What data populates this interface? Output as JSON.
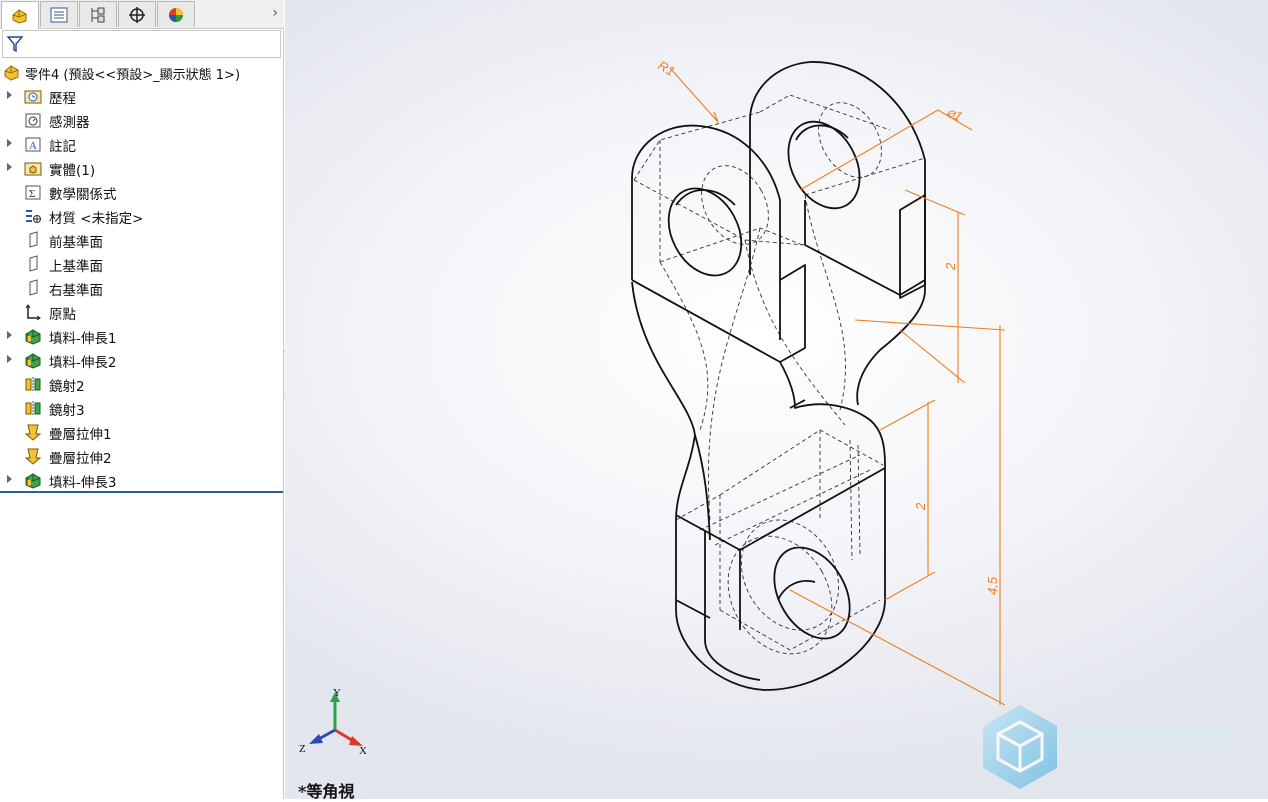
{
  "tabs": [
    {
      "icon": "feature-manager-icon",
      "active": true
    },
    {
      "icon": "property-manager-icon",
      "active": false
    },
    {
      "icon": "configuration-manager-icon",
      "active": false
    },
    {
      "icon": "dimxpert-icon",
      "active": false
    },
    {
      "icon": "display-manager-icon",
      "active": false
    }
  ],
  "tab_more_glyph": "›",
  "part": {
    "label": "零件4  (預設<<預設>_顯示狀態 1>)"
  },
  "tree": [
    {
      "label": "歷程",
      "icon": "history-icon",
      "expandable": true
    },
    {
      "label": "感測器",
      "icon": "sensors-icon",
      "expandable": false
    },
    {
      "label": "註記",
      "icon": "annotations-icon",
      "expandable": true
    },
    {
      "label": "實體(1)",
      "icon": "solid-bodies-icon",
      "expandable": true
    },
    {
      "label": "數學關係式",
      "icon": "equations-icon",
      "expandable": false
    },
    {
      "label": "材質 <未指定>",
      "icon": "material-icon",
      "expandable": false
    },
    {
      "label": "前基準面",
      "icon": "plane-icon",
      "expandable": false
    },
    {
      "label": "上基準面",
      "icon": "plane-icon",
      "expandable": false
    },
    {
      "label": "右基準面",
      "icon": "plane-icon",
      "expandable": false
    },
    {
      "label": "原點",
      "icon": "origin-icon",
      "expandable": false
    },
    {
      "label": "填料-伸長1",
      "icon": "extrude-icon",
      "expandable": true
    },
    {
      "label": "填料-伸長2",
      "icon": "extrude-icon",
      "expandable": true
    },
    {
      "label": "鏡射2",
      "icon": "mirror-icon",
      "expandable": false
    },
    {
      "label": "鏡射3",
      "icon": "mirror-icon",
      "expandable": false
    },
    {
      "label": "疊層拉伸1",
      "icon": "loft-icon",
      "expandable": false
    },
    {
      "label": "疊層拉伸2",
      "icon": "loft-icon",
      "expandable": false
    },
    {
      "label": "填料-伸長3",
      "icon": "extrude-icon",
      "expandable": true
    }
  ],
  "viewport": {
    "view_name": "*等角視",
    "triad": {
      "x": "X",
      "y": "Y",
      "z": "Z"
    },
    "dimensions": {
      "radius": "R1",
      "diameter": "⌀1",
      "upper_height": "2",
      "lower_height": "2",
      "overall_height": "4.5"
    }
  },
  "colors": {
    "dimension": "#ee7f1a",
    "model_edge": "#111111",
    "hidden_edge": "#333333",
    "watermark": "#7ec8e8"
  }
}
